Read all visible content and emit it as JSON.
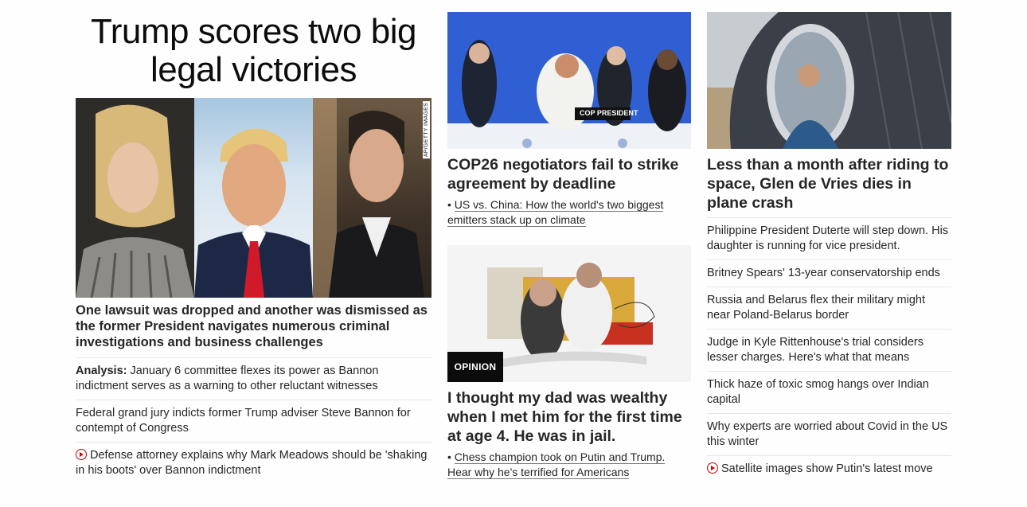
{
  "hero": {
    "title": "Trump scores two big legal victories",
    "image_credit": "AP/GETTY IMAGES",
    "summary": "One lawsuit was dropped and another was dismissed as the former President navigates numerous criminal investigations and business challenges",
    "items": [
      {
        "prefix": "Analysis:",
        "text": " January 6 committee flexes its power as Bannon indictment serves as a warning to other reluctant witnesses"
      },
      {
        "text": "Federal grand jury indicts former Trump adviser Steve Bannon for contempt of Congress"
      },
      {
        "text": "Defense attorney explains why Mark Meadows should be 'shaking in his boots' over Bannon indictment",
        "video": true
      }
    ]
  },
  "middle": {
    "cop": {
      "image_sign": "COP PRESIDENT",
      "headline": "COP26 negotiators fail to strike agreement by deadline",
      "sub": "US vs. China: How the world's two biggest emitters stack up on climate"
    },
    "opinion": {
      "badge": "OPINION",
      "headline": "I thought my dad was wealthy when I met him for the first time at age 4. He was in jail.",
      "sub": "Chess champion took on Putin and Trump. Hear why he's terrified for Americans"
    }
  },
  "right": {
    "headline": "Less than a month after riding to space, Glen de Vries dies in plane crash",
    "items": [
      {
        "text": "Philippine President Duterte will step down. His daughter is running for vice president."
      },
      {
        "text": "Britney Spears' 13-year conservatorship ends"
      },
      {
        "text": "Russia and Belarus flex their military might near Poland-Belarus border"
      },
      {
        "text": "Judge in Kyle Rittenhouse's trial considers lesser charges. Here's what that means"
      },
      {
        "text": "Thick haze of toxic smog hangs over Indian capital"
      },
      {
        "text": "Why experts are worried about Covid in the US this winter"
      },
      {
        "text": "Satellite images show Putin's latest move",
        "video": true
      }
    ]
  },
  "colors": {
    "accent_red": "#cc0000",
    "text": "#262626",
    "divider": "#e6e6e6",
    "badge_bg": "#0c0c0c"
  }
}
